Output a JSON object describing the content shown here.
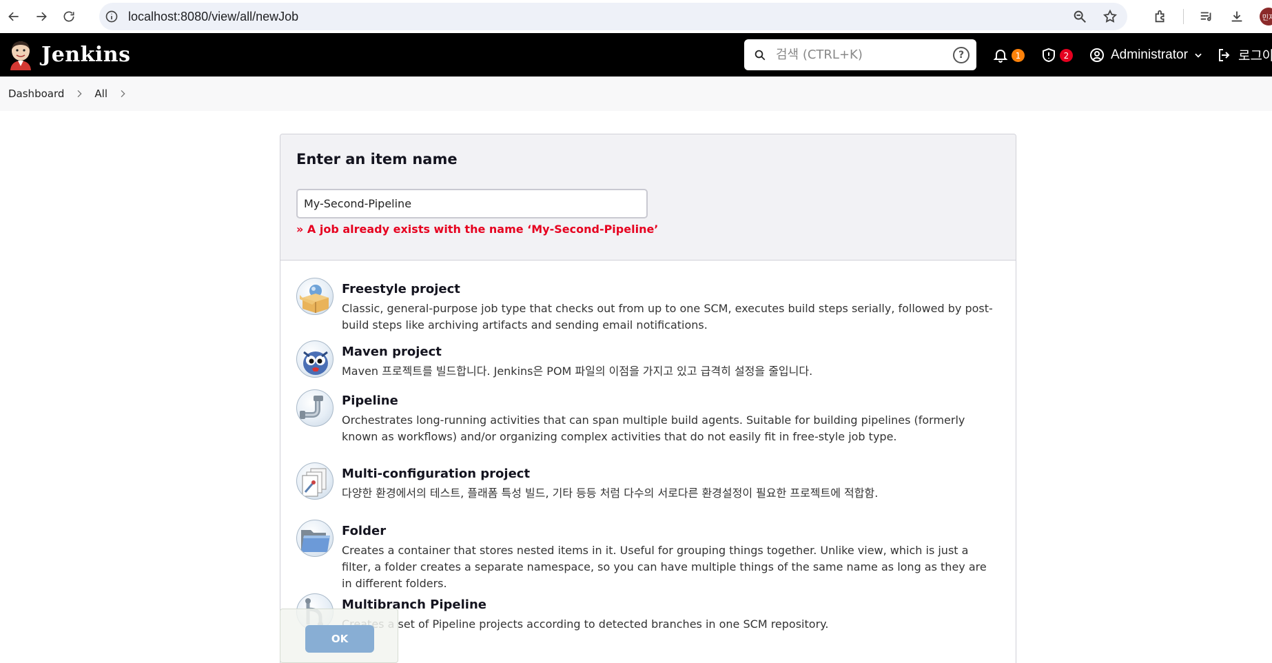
{
  "browser": {
    "url": "localhost:8080/view/all/newJob",
    "profile_initials": "민지"
  },
  "header": {
    "logo_text": "Jenkins",
    "search_placeholder": "검색 (CTRL+K)",
    "help_label": "?",
    "notifications_count": "1",
    "security_count": "2",
    "user_name": "Administrator",
    "logout_label": "로그아웃"
  },
  "breadcrumb": {
    "items": [
      "Dashboard",
      "All"
    ]
  },
  "form": {
    "title": "Enter an item name",
    "item_name_value": "My-Second-Pipeline",
    "error": "» A job already exists with the name ‘My-Second-Pipeline’"
  },
  "items": [
    {
      "name": "Freestyle project",
      "description": "Classic, general-purpose job type that checks out from up to one SCM, executes build steps serially, followed by post-build steps like archiving artifacts and sending email notifications.",
      "icon": "freestyle-box-icon"
    },
    {
      "name": "Maven project",
      "description": "Maven 프로젝트를 빌드합니다. Jenkins은 POM 파일의 이점을 가지고 있고 급격히 설정을 줄입니다.",
      "icon": "maven-owl-icon"
    },
    {
      "name": "Pipeline",
      "description": "Orchestrates long-running activities that can span multiple build agents. Suitable for building pipelines (formerly known as workflows) and/or organizing complex activities that do not easily fit in free-style job type.",
      "icon": "pipe-icon"
    },
    {
      "name": "Multi-configuration project",
      "description": "다양한 환경에서의 테스트, 플래폼 특성 빌드, 기타 등등 처럼 다수의 서로다른 환경설정이 필요한 프로젝트에 적합함.",
      "icon": "multi-config-icon"
    },
    {
      "name": "Folder",
      "description": "Creates a container that stores nested items in it. Useful for grouping things together. Unlike view, which is just a filter, a folder creates a separate namespace, so you can have multiple things of the same name as long as they are in different folders.",
      "icon": "folder-icon"
    },
    {
      "name": "Multibranch Pipeline",
      "description": "Creates a set of Pipeline projects according to detected branches in one SCM repository.",
      "icon": "multibranch-icon"
    }
  ],
  "ok_label": "OK"
}
